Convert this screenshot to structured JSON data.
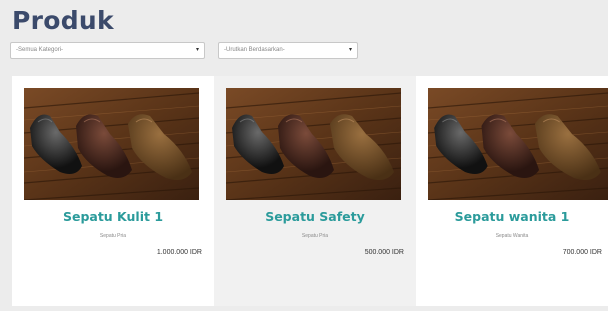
{
  "page": {
    "title": "Produk"
  },
  "filters": {
    "category": {
      "value": "-Semua Kategori-",
      "caret": "▾"
    },
    "sort": {
      "value": "-Urutkan Berdasarkan-",
      "caret": "▾"
    }
  },
  "products": [
    {
      "name": "Sepatu Kulit 1",
      "category": "Sepatu Pria",
      "price": "1.000.000 IDR",
      "image": "leather-shoes-photo"
    },
    {
      "name": "Sepatu Safety",
      "category": "Sepatu Pria",
      "price": "500.000 IDR",
      "image": "leather-shoes-photo"
    },
    {
      "name": "Sepatu wanita 1",
      "category": "Sepatu Wanita",
      "price": "700.000 IDR",
      "image": "leather-shoes-photo"
    }
  ],
  "colors": {
    "title": "#3b4a6b",
    "product_name": "#2b9b9b",
    "background": "#ececec"
  }
}
